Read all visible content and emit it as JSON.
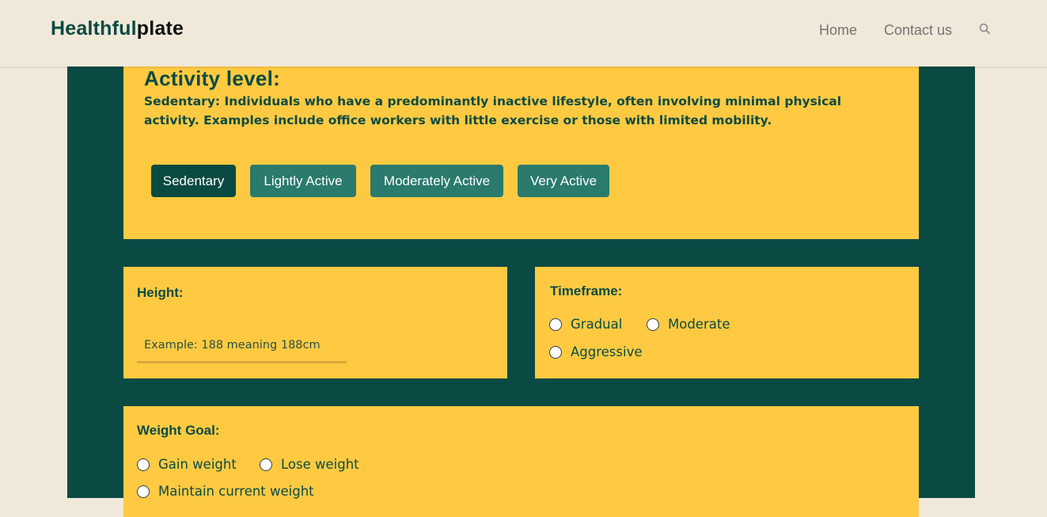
{
  "header": {
    "brand_part1": "Healthful",
    "brand_part2": "plate",
    "nav": {
      "home": "Home",
      "contact": "Contact us"
    },
    "search_icon": "search-icon"
  },
  "colors": {
    "page_background": "#f0e9da",
    "dark_green": "#0b4a42",
    "card_yellow": "#ffca42",
    "button_teal": "#2a7a6e"
  },
  "activity": {
    "title": "Activity level:",
    "description": "Sedentary: Individuals who have a predominantly inactive lifestyle, often involving minimal physical activity. Examples include office workers with little exercise or those with limited mobility.",
    "options": [
      "Sedentary",
      "Lightly Active",
      "Moderately Active",
      "Very Active"
    ],
    "selected": "Sedentary"
  },
  "height": {
    "label": "Height:",
    "value": "",
    "placeholder": "Example: 188 meaning 188cm"
  },
  "timeframe": {
    "label": "Timeframe:",
    "options": [
      "Gradual",
      "Moderate",
      "Aggressive"
    ]
  },
  "weight_goal": {
    "label": "Weight Goal:",
    "options": [
      "Gain weight",
      "Lose weight",
      "Maintain current weight"
    ]
  }
}
